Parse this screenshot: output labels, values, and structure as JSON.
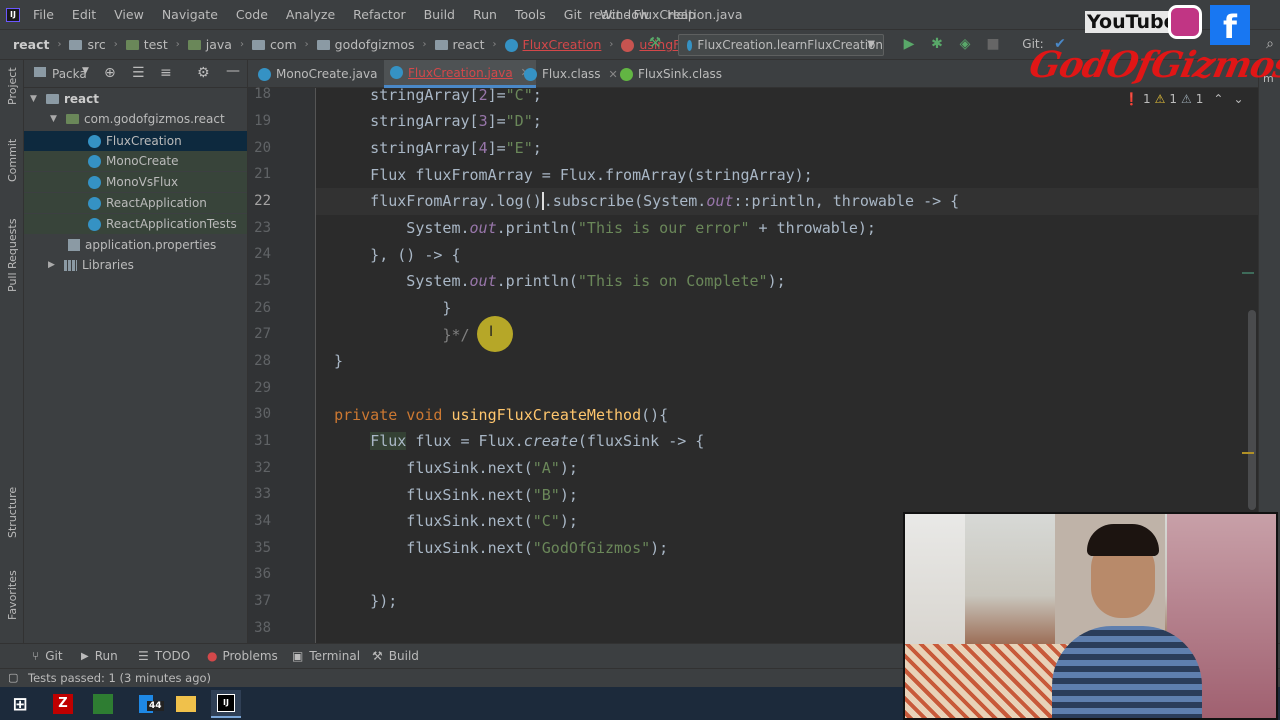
{
  "app": {
    "menus": [
      "File",
      "Edit",
      "View",
      "Navigate",
      "Code",
      "Analyze",
      "Refactor",
      "Build",
      "Run",
      "Tools",
      "Git",
      "Window",
      "Help"
    ],
    "window_title": "react - FluxCreation.java"
  },
  "breadcrumb": {
    "items": [
      "react",
      "src",
      "test",
      "java",
      "com",
      "godofgizmos",
      "react",
      "FluxCreation",
      "usingFluxFromArrays"
    ]
  },
  "run_config": {
    "label": "FluxCreation.learnFluxCreation",
    "git_label": "Git:"
  },
  "left_strip": {
    "project": "Project",
    "commit": "Commit",
    "pull_requests": "Pull Requests",
    "structure": "Structure",
    "favorites": "Favorites"
  },
  "project_panel": {
    "header": "Packa",
    "items": [
      {
        "label": "react",
        "level": 0,
        "kind": "folder"
      },
      {
        "label": "com.godofgizmos.react",
        "level": 1,
        "kind": "package"
      },
      {
        "label": "FluxCreation",
        "level": 2,
        "kind": "class",
        "selected": true
      },
      {
        "label": "MonoCreate",
        "level": 2,
        "kind": "class"
      },
      {
        "label": "MonoVsFlux",
        "level": 2,
        "kind": "class"
      },
      {
        "label": "ReactApplication",
        "level": 2,
        "kind": "class"
      },
      {
        "label": "ReactApplicationTests",
        "level": 2,
        "kind": "class"
      },
      {
        "label": "application.properties",
        "level": 1,
        "kind": "file"
      },
      {
        "label": "Libraries",
        "level": 1,
        "kind": "lib"
      }
    ]
  },
  "tabs": [
    {
      "label": "MonoCreate.java",
      "active": false
    },
    {
      "label": "FluxCreation.java",
      "active": true
    },
    {
      "label": "Flux.class",
      "active": false
    },
    {
      "label": "FluxSink.class",
      "active": false
    }
  ],
  "inspections": {
    "errors": "1",
    "warnings": "1",
    "weak_warnings": "1"
  },
  "editor": {
    "line_numbers": [
      "18",
      "19",
      "20",
      "21",
      "22",
      "23",
      "24",
      "25",
      "26",
      "27",
      "28",
      "29",
      "30",
      "31",
      "32",
      "33",
      "34",
      "35",
      "36",
      "37",
      "38"
    ],
    "current_line": "22"
  },
  "bottom_tools": {
    "git": "Git",
    "run": "Run",
    "todo": "TODO",
    "problems": "Problems",
    "terminal": "Terminal",
    "build": "Build"
  },
  "status": {
    "message": "Tests passed: 1 (3 minutes ago)"
  },
  "taskbar": {
    "badge": "44"
  },
  "overlay": {
    "watermark": "GodOfGizmos",
    "youtube": "YouTube"
  },
  "colors": {
    "background": "#2b2b2b",
    "keyword": "#cc7832",
    "string": "#6a8759",
    "text": "#a9b7c6",
    "accent": "#4a88c7",
    "watermark": "#e01616"
  }
}
